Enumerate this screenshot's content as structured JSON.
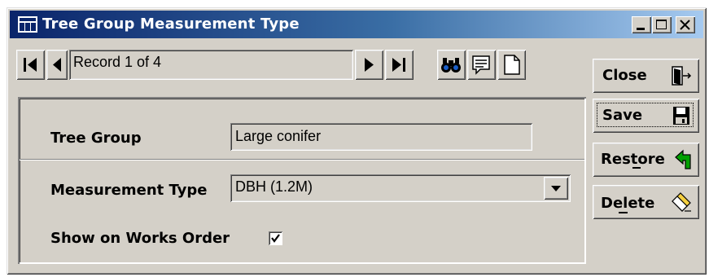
{
  "window": {
    "title": "Tree Group Measurement Type",
    "controls": [
      "minimize-icon",
      "maximize-icon",
      "close-icon"
    ]
  },
  "navigator": {
    "record_text": "Record 1 of 4",
    "icons": [
      "first-record-icon",
      "previous-record-icon",
      "next-record-icon",
      "last-record-icon",
      "binoculars-icon",
      "notes-icon",
      "new-record-icon"
    ]
  },
  "form": {
    "tree_group_label": "Tree Group",
    "tree_group_value": "Large conifer",
    "measurement_type_label": "Measurement Type",
    "measurement_type_value": "DBH (1.2M)",
    "show_on_works_order_label": "Show on Works Order",
    "show_on_works_order_checked": true
  },
  "side_buttons": {
    "close_label": "Close",
    "save_label": "Save",
    "restore_label": "Restore",
    "delete_label": "Delete"
  },
  "colors": {
    "titlebar_start": "#0a246a",
    "titlebar_end": "#a6caf0",
    "face": "#d4d0c8",
    "restore_arrow": "#00a000"
  }
}
